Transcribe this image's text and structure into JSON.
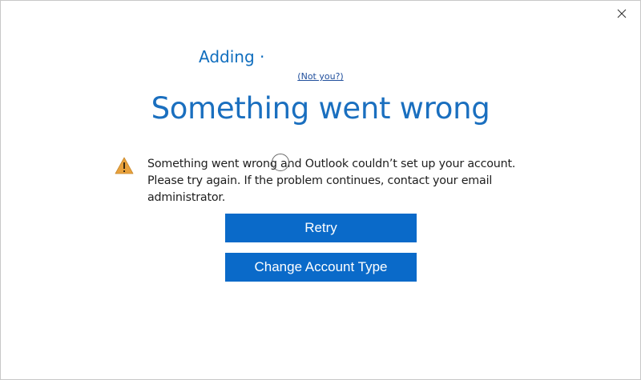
{
  "dialog": {
    "adding_label": "Adding ·",
    "not_you_link": "(Not you?)",
    "headline": "Something went wrong",
    "message": "Something went wrong and Outlook couldn’t set up your account. Please try again. If the problem continues, contact your email administrator.",
    "retry_label": "Retry",
    "change_account_label": "Change Account Type"
  },
  "icons": {
    "close": "close-icon",
    "warning": "warning-icon"
  },
  "colors": {
    "accent_text": "#1a6fbf",
    "button_bg": "#0a6ac9",
    "button_text": "#ffffff",
    "warning_fill": "#e8a13c"
  }
}
